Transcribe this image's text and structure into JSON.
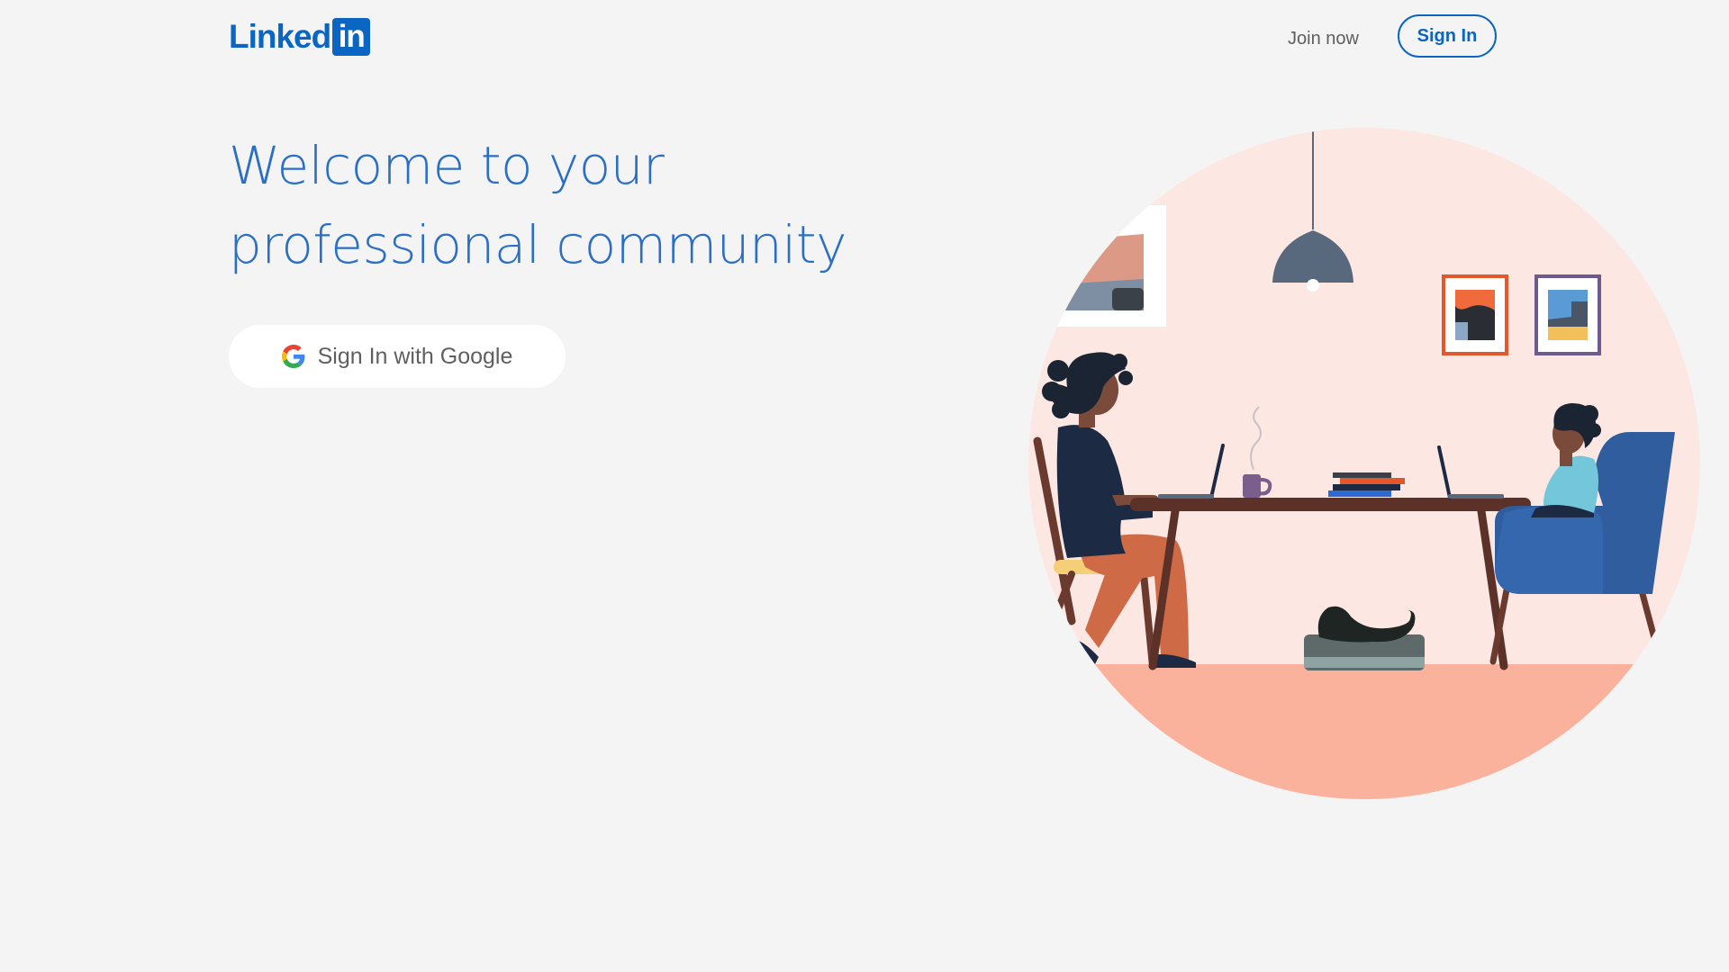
{
  "header": {
    "logo_text": "Linked",
    "logo_box_text": "in",
    "join_now_label": "Join now",
    "sign_in_label": "Sign In"
  },
  "hero": {
    "title": "Welcome to your professional community",
    "google_button_label": "Sign In with Google"
  },
  "colors": {
    "brand_blue": "#0a66c2",
    "title_blue": "#2b6fc4",
    "page_background": "#f4f4f4",
    "illustration_wall": "#fde7e3",
    "illustration_floor": "#fbb29c"
  },
  "icons": {
    "google": "google-g-icon"
  }
}
